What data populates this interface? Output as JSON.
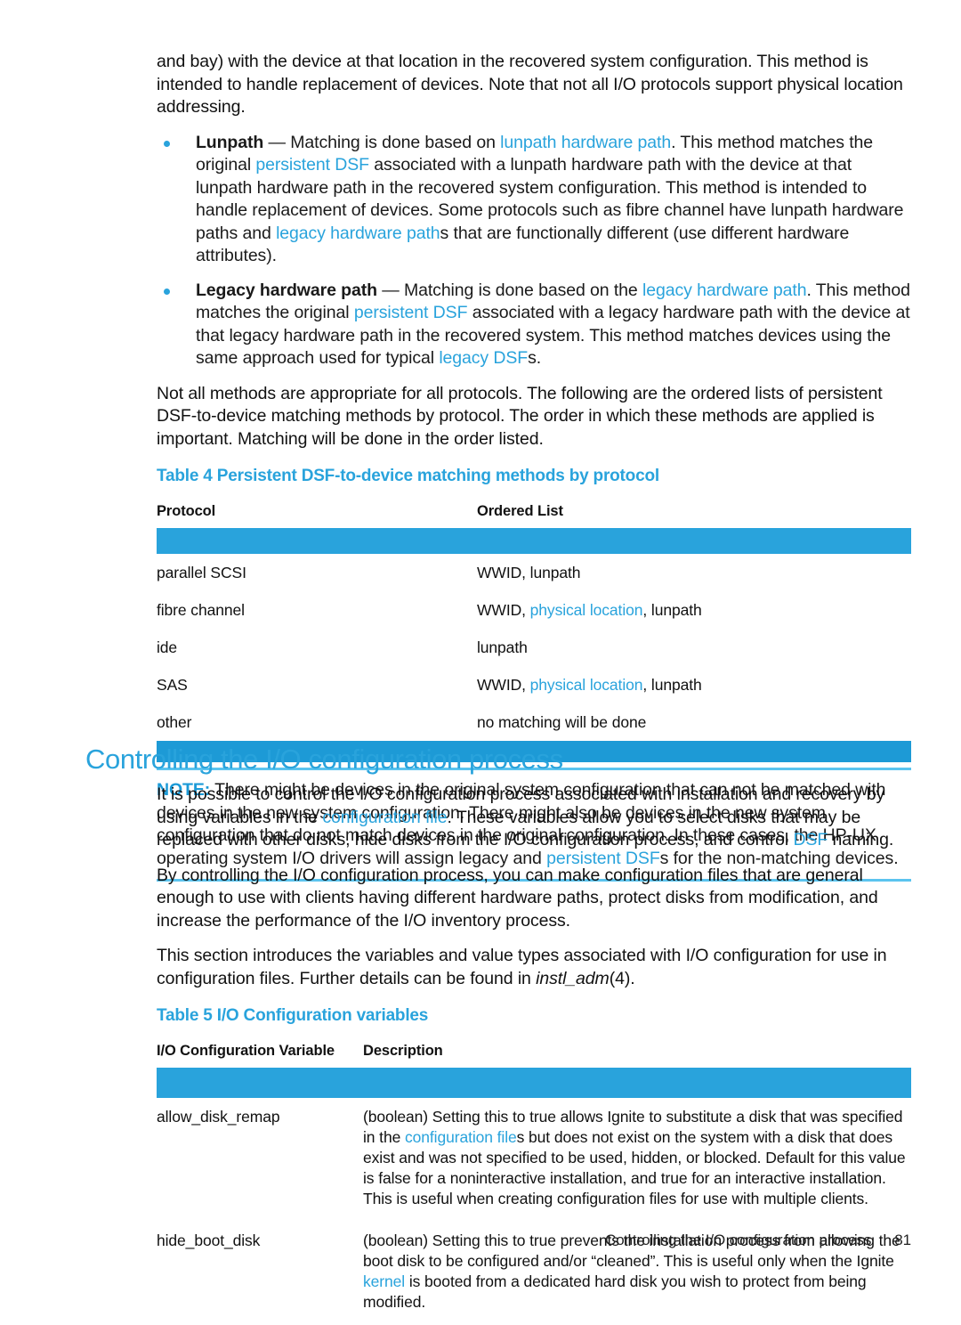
{
  "colors": {
    "accent": "#29a3dc",
    "link": "#29a3dc",
    "rule": "#1d9ad6",
    "note_rule": "#5bc4ef",
    "text": "#111111"
  },
  "intro_paragraph": {
    "text": "and bay) with the device at that location in the recovered system configuration. This method is intended to handle replacement of devices. Note that not all I/O protocols support physical location addressing."
  },
  "bullets": [
    {
      "term": "Lunpath",
      "dash": "—",
      "segments": [
        {
          "text": " Matching is done based on ",
          "link": false
        },
        {
          "text": "lunpath hardware path",
          "link": true
        },
        {
          "text": ". This method matches the original ",
          "link": false
        },
        {
          "text": "persistent DSF",
          "link": true
        },
        {
          "text": " associated with a lunpath hardware path with the device at that lunpath hardware path in the recovered system configuration. This method is intended to handle replacement of devices. Some protocols such as fibre channel have lunpath hardware paths and ",
          "link": false
        },
        {
          "text": "legacy hardware path",
          "link": true
        },
        {
          "text": "s that are functionally different (use different hardware attributes).",
          "link": false
        }
      ]
    },
    {
      "term": "Legacy hardware path",
      "dash": "—",
      "segments": [
        {
          "text": " Matching is done based on the ",
          "link": false
        },
        {
          "text": "legacy hardware path",
          "link": true
        },
        {
          "text": ". This method matches the original ",
          "link": false
        },
        {
          "text": "persistent DSF",
          "link": true
        },
        {
          "text": " associated with a legacy hardware path with the device at that legacy hardware path in the recovered system. This method matches devices using the same approach used for typical ",
          "link": false
        },
        {
          "text": "legacy DSF",
          "link": true
        },
        {
          "text": "s.",
          "link": false
        }
      ]
    }
  ],
  "after_bullets_paragraph": {
    "text": "Not all methods are appropriate for all protocols. The following are the ordered lists of persistent DSF-to-device matching methods by protocol. The order in which these methods are applied is important. Matching will be done in the order listed."
  },
  "table4": {
    "caption": "Table 4 Persistent DSF-to-device matching methods by protocol",
    "headers": [
      "Protocol",
      "Ordered List"
    ],
    "rows": [
      {
        "protocol": "parallel SCSI",
        "ordered_list": [
          {
            "text": "WWID, lunpath",
            "link": false
          }
        ]
      },
      {
        "protocol": "fibre channel",
        "ordered_list": [
          {
            "text": "WWID, ",
            "link": false
          },
          {
            "text": "physical location",
            "link": true
          },
          {
            "text": ", lunpath",
            "link": false
          }
        ]
      },
      {
        "protocol": "ide",
        "ordered_list": [
          {
            "text": "lunpath",
            "link": false
          }
        ]
      },
      {
        "protocol": "SAS",
        "ordered_list": [
          {
            "text": "WWID, ",
            "link": false
          },
          {
            "text": "physical location",
            "link": true
          },
          {
            "text": ", lunpath",
            "link": false
          }
        ]
      },
      {
        "protocol": "other",
        "ordered_list": [
          {
            "text": "no matching will be done",
            "link": false
          }
        ]
      }
    ]
  },
  "note": {
    "label": "NOTE:",
    "segments": [
      {
        "text": "   There might be devices in the original system configuration that can not be matched with devices in the new system configuration. There might also be devices in the new system configuration that do not match devices in the original configuration. In these cases, the HP-UX operating system I/O drivers will assign legacy and ",
        "link": false
      },
      {
        "text": "persistent DSF",
        "link": true
      },
      {
        "text": "s for the non-matching devices.",
        "link": false
      }
    ]
  },
  "section": {
    "heading": "Controlling the I/O configuration process",
    "paragraphs": [
      {
        "segments": [
          {
            "text": "It is possible to control the I/O configuration process associated with installation and recovery by using variables in the ",
            "link": false
          },
          {
            "text": "configuration file",
            "link": true
          },
          {
            "text": ". These variables allow you to select disks that may be replaced with other disks, hide disks from the I/O configuration process, and control ",
            "link": false
          },
          {
            "text": "DSF",
            "link": true
          },
          {
            "text": " naming.",
            "link": false
          }
        ]
      },
      {
        "segments": [
          {
            "text": "By controlling the I/O configuration process, you can make configuration files that are general enough to use with clients having different hardware paths, protect disks from modification, and increase the performance of the I/O inventory process.",
            "link": false
          }
        ]
      },
      {
        "segments": [
          {
            "text": "This section introduces the variables and value types associated with I/O configuration for use in configuration files. Further details can be found in ",
            "link": false
          },
          {
            "text": "instl_adm",
            "link": false,
            "italic": true
          },
          {
            "text": "(4).",
            "link": false
          }
        ]
      }
    ]
  },
  "table5": {
    "caption": "Table 5 I/O Configuration variables",
    "headers": [
      "I/O Configuration Variable",
      "Description"
    ],
    "rows": [
      {
        "variable": "allow_disk_remap",
        "description": [
          {
            "text": "(boolean) Setting this to true allows Ignite to substitute a disk that was specified in the ",
            "link": false
          },
          {
            "text": "configuration file",
            "link": true
          },
          {
            "text": "s but does not exist on the system with a disk that does exist and was not specified to be used, hidden, or blocked. Default for this value is false for a noninteractive installation, and true for an interactive installation. This is useful when creating configuration files for use with multiple clients.",
            "link": false
          }
        ]
      },
      {
        "variable": "hide_boot_disk",
        "description": [
          {
            "text": "(boolean) Setting this to true prevents the installation process from allowing the boot disk to be configured and/or “cleaned”. This is useful only when the Ignite ",
            "link": false
          },
          {
            "text": "kernel",
            "link": true
          },
          {
            "text": " is booted from a dedicated hard disk you wish to protect from being modified.",
            "link": false
          }
        ]
      }
    ]
  },
  "footer": {
    "title": "Controlling the I/O configuration process",
    "page_number": "81"
  }
}
